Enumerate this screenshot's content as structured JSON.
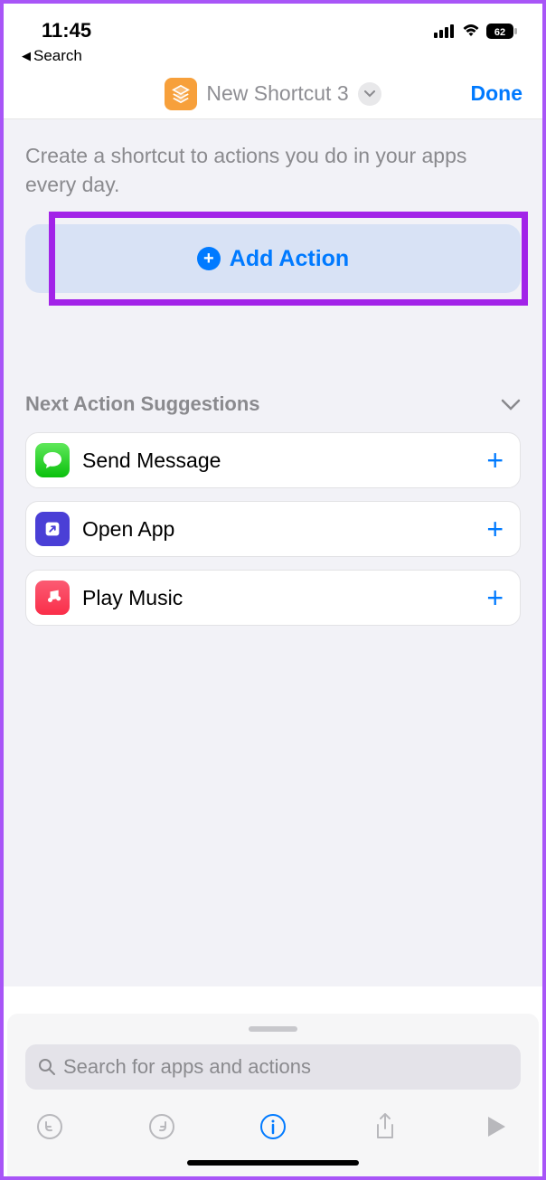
{
  "statusBar": {
    "time": "11:45",
    "battery": "62"
  },
  "backNav": {
    "label": "Search"
  },
  "header": {
    "title": "New Shortcut 3",
    "doneLabel": "Done"
  },
  "intro": "Create a shortcut to actions you do in your apps every day.",
  "addAction": {
    "label": "Add Action"
  },
  "suggestions": {
    "title": "Next Action Suggestions",
    "items": [
      {
        "label": "Send Message",
        "icon": "messages"
      },
      {
        "label": "Open App",
        "icon": "shortcuts"
      },
      {
        "label": "Play Music",
        "icon": "music"
      }
    ]
  },
  "search": {
    "placeholder": "Search for apps and actions"
  }
}
